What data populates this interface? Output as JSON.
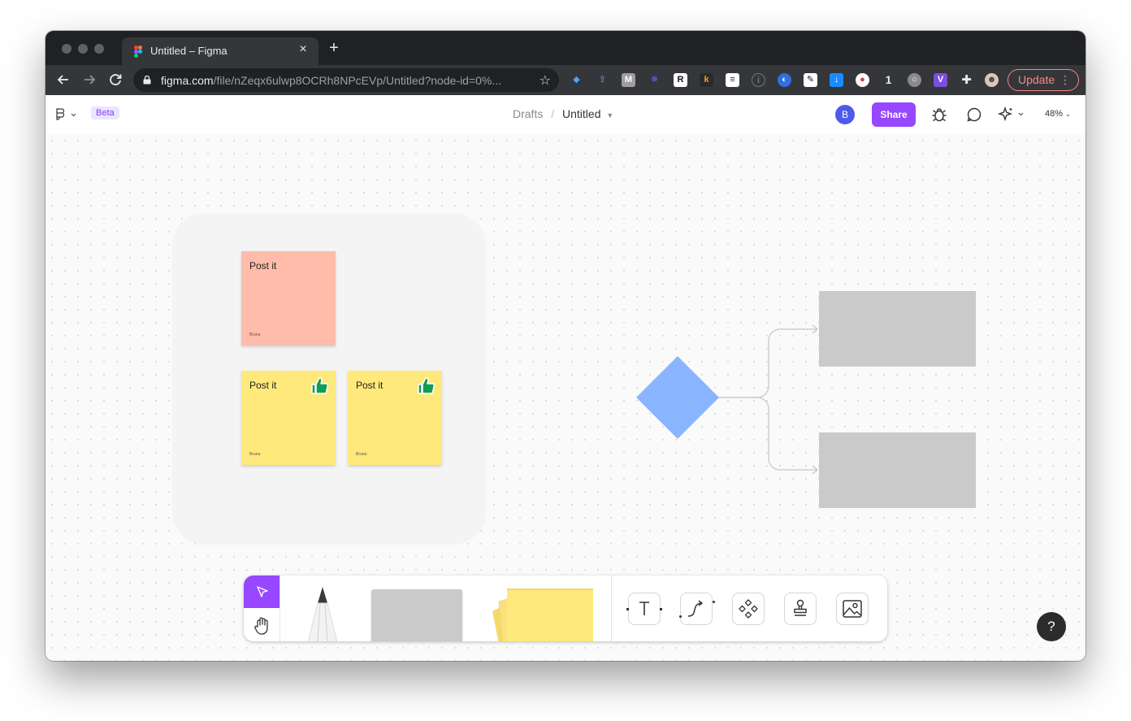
{
  "browser": {
    "tab_title": "Untitled – Figma",
    "tab_close": "×",
    "new_tab": "+",
    "url_host": "figma.com",
    "url_path": "/file/nZeqx6ulwp8OCRh8NPcEVp/Untitled?node-id=0%...",
    "ext_count": "1",
    "update_label": "Update",
    "update_menu": "⋮"
  },
  "figma": {
    "beta_label": "Beta",
    "breadcrumb_folder": "Drafts",
    "breadcrumb_separator": "/",
    "file_name": "Untitled",
    "avatar_initial": "B",
    "share_label": "Share",
    "zoom_level": "48%",
    "help_label": "?"
  },
  "canvas": {
    "stickies": [
      {
        "text": "Post it",
        "author": "Bruna",
        "color": "#ffbcab"
      },
      {
        "text": "Post it",
        "author": "Bruna",
        "color": "#ffe97c",
        "reaction": "thumbs-up"
      },
      {
        "text": "Post it",
        "author": "Bruna",
        "color": "#ffe97c",
        "reaction": "thumbs-up"
      }
    ],
    "diamond_color": "#89b4ff",
    "rect_color": "#cbcaca"
  },
  "colors": {
    "accent": "#9747ff",
    "chrome_dark": "#202124",
    "chrome_toolbar": "#35363a"
  },
  "dock": {
    "tools": [
      "cursor-icon",
      "hand-icon",
      "marker-icon",
      "shape-icon",
      "sticky-note-icon",
      "text-icon",
      "connector-icon",
      "component-icon",
      "stamp-icon",
      "image-icon"
    ]
  }
}
